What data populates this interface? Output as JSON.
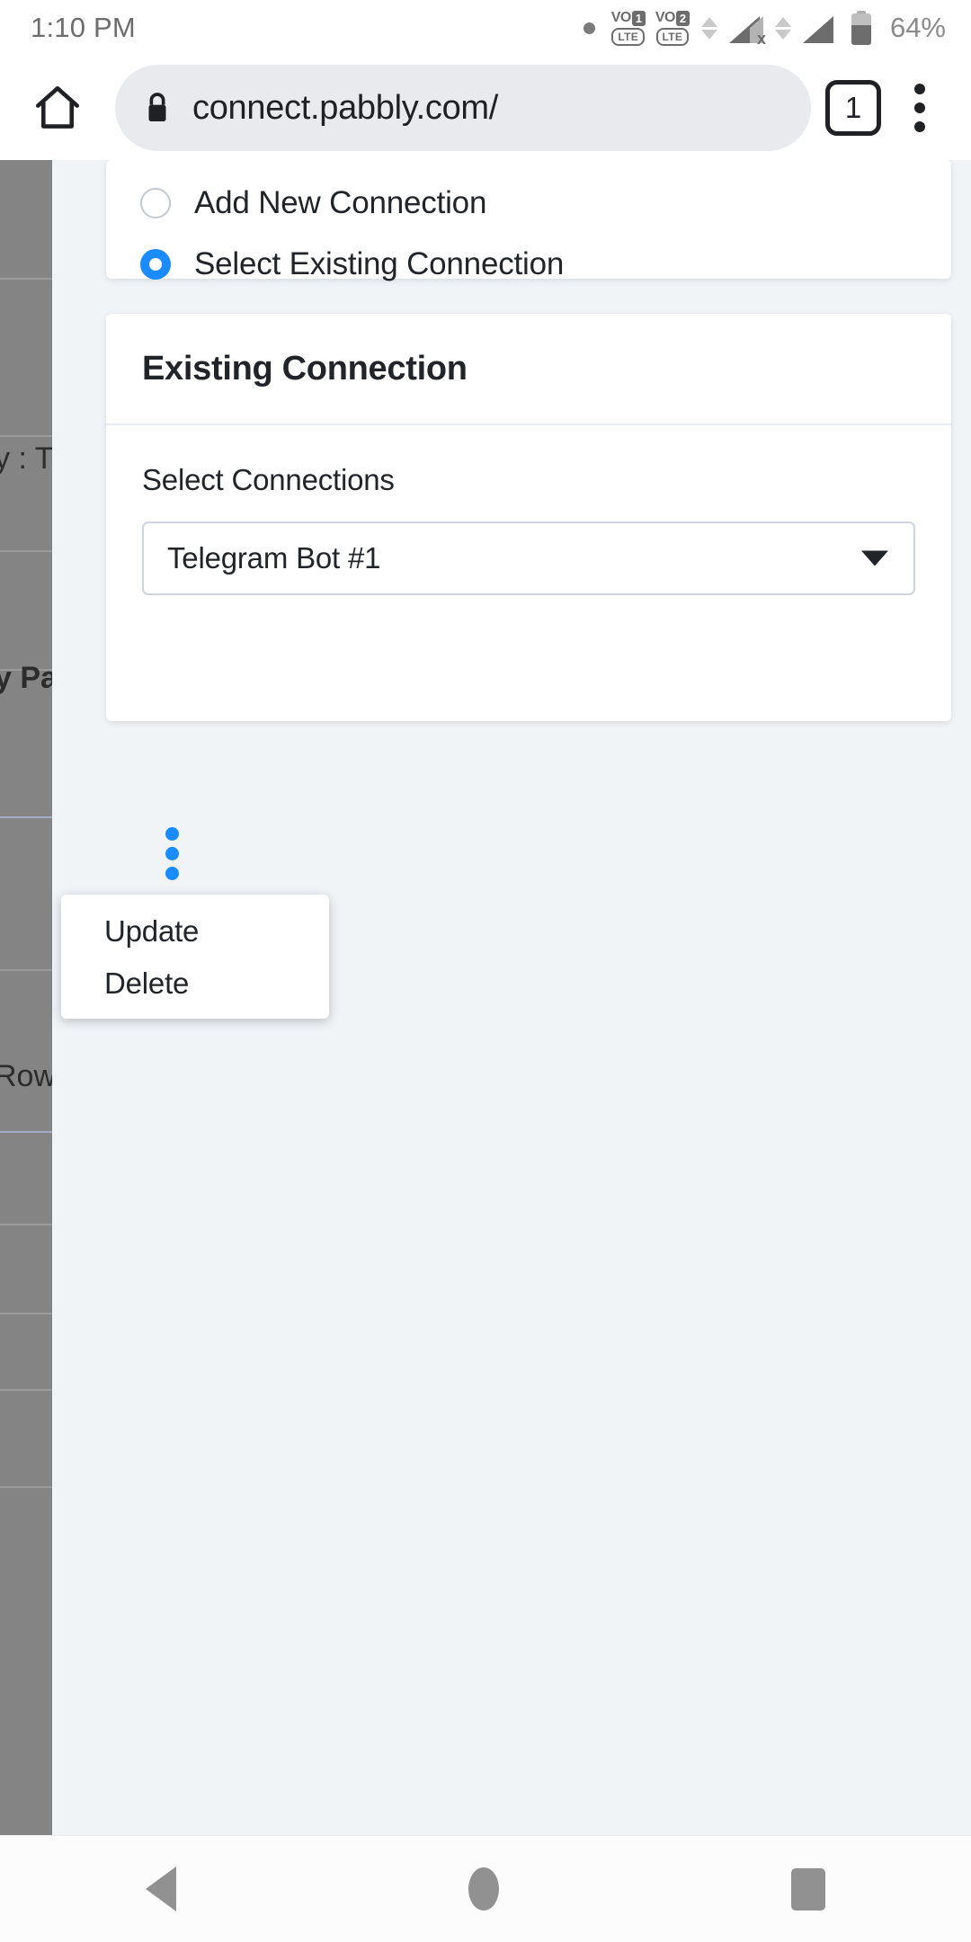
{
  "status_bar": {
    "time": "1:10 PM",
    "battery_percent": "64%",
    "battery_level": 64,
    "sim1_label": "VO",
    "sim1_number": "1",
    "sim1_network": "LTE",
    "sim2_label": "VO",
    "sim2_number": "2",
    "sim2_network": "LTE",
    "icons": [
      "dot-indicator",
      "volte-sim1-icon",
      "volte-sim2-icon",
      "data-arrows-icon",
      "signal-sim1-icon",
      "signal-sim2-icon",
      "battery-icon"
    ]
  },
  "browser": {
    "home_icon": "home-icon",
    "lock_icon": "lock-icon",
    "url": "connect.pabbly.com/",
    "tab_count": "1",
    "menu_icon": "kebab-menu-icon"
  },
  "connection_choice": {
    "options": [
      {
        "label": "Add New Connection",
        "selected": false
      },
      {
        "label": "Select Existing Connection",
        "selected": true
      }
    ]
  },
  "existing_connection": {
    "title": "Existing Connection",
    "field_label": "Select Connections",
    "selected_value": "Telegram Bot #1",
    "caret_icon": "chevron-down-icon",
    "options_icon": "vertical-dots-icon"
  },
  "context_menu": {
    "items": [
      {
        "label": "Update"
      },
      {
        "label": "Delete"
      }
    ]
  },
  "background_panel": {
    "fragments": [
      {
        "text": "y : T",
        "bold": false
      },
      {
        "text": "y Pab",
        "bold": true
      },
      {
        "text": "Row",
        "bold": false
      }
    ]
  },
  "nav_bar": {
    "back_icon": "back-triangle-icon",
    "home_icon": "home-circle-icon",
    "recents_icon": "recents-square-icon"
  },
  "colors": {
    "accent_blue": "#1a8cff",
    "page_bg": "#f0f4f7",
    "card_bg": "#ffffff",
    "url_pill_bg": "#e8eaed",
    "text_primary": "#212529",
    "dim_overlay": "#848484"
  }
}
